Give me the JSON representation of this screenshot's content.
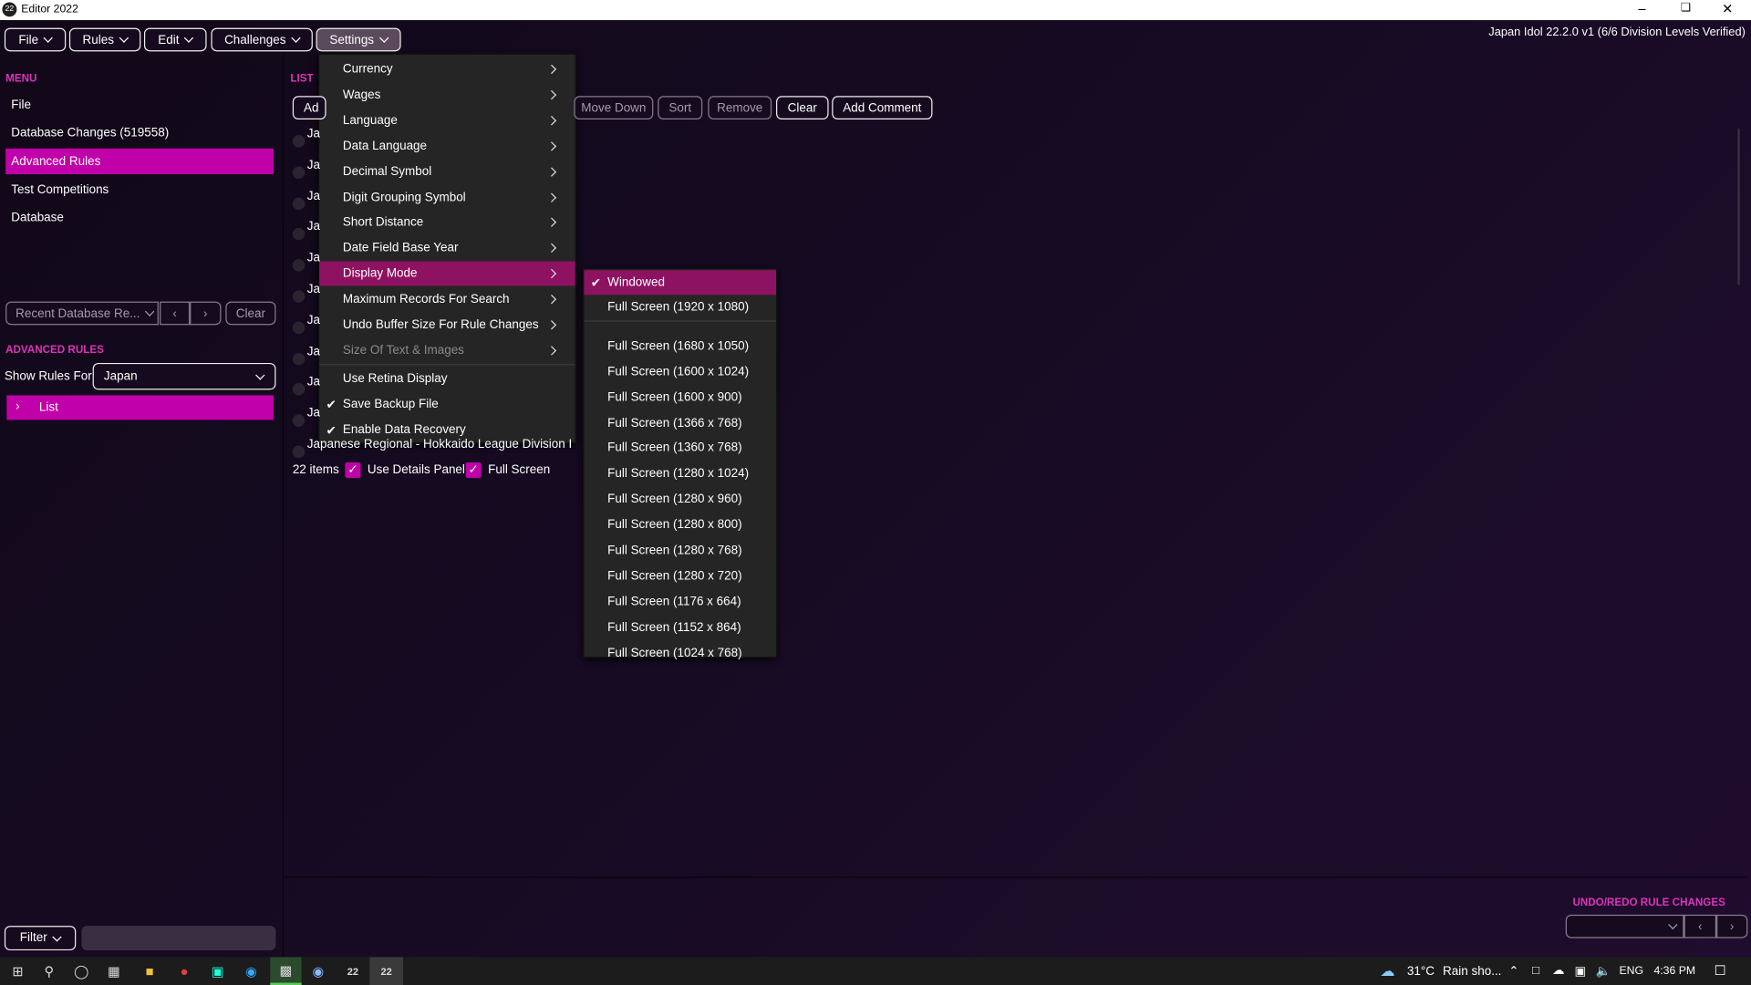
{
  "window": {
    "title": "Editor 2022",
    "version": "Japan Idol 22.2.0 v1 (6/6 Division Levels Verified)"
  },
  "menubar": [
    "File",
    "Rules",
    "Edit",
    "Challenges",
    "Settings"
  ],
  "sidebar": {
    "heading": "MENU",
    "items": [
      "File",
      "Database Changes (519558)",
      "Advanced Rules",
      "Test Competitions",
      "Database"
    ],
    "selected": "Advanced Rules",
    "recent": {
      "label": "Recent Database Re...",
      "clear": "Clear"
    },
    "adv_heading": "ADVANCED RULES",
    "show_rules_label": "Show Rules For",
    "show_rules_value": "Japan",
    "tree_item": "List",
    "filter": {
      "label": "Filter",
      "value": ""
    }
  },
  "list": {
    "heading": "LIST",
    "toolbar": [
      "Ad",
      "Move Down",
      "Sort",
      "Remove",
      "Clear",
      "Add Comment"
    ],
    "rows": [
      "Ja",
      "Ja",
      "Ja",
      "Ja",
      "Ja",
      "Ja",
      "Ja",
      "Ja",
      "Ja",
      "Ja",
      "Japanese Regional - Hokkaido League Division I"
    ],
    "count": "22 items",
    "use_details_panel": {
      "label": "Use Details Panel",
      "checked": true
    },
    "full_screen": {
      "label": "Full Screen",
      "checked": true
    }
  },
  "settings_menu": {
    "items": [
      {
        "label": "Currency",
        "submenu": true
      },
      {
        "label": "Wages",
        "submenu": true
      },
      {
        "label": "Language",
        "submenu": true
      },
      {
        "label": "Data Language",
        "submenu": true
      },
      {
        "label": "Decimal Symbol",
        "submenu": true
      },
      {
        "label": "Digit Grouping Symbol",
        "submenu": true
      },
      {
        "label": "Short Distance",
        "submenu": true
      },
      {
        "label": "Date Field Base Year",
        "submenu": true
      },
      {
        "label": "Display Mode",
        "submenu": true,
        "highlighted": true
      },
      {
        "label": "Maximum Records For Search",
        "submenu": true
      },
      {
        "label": "Undo Buffer Size For Rule Changes",
        "submenu": true
      },
      {
        "label": "Size Of Text & Images",
        "submenu": true,
        "disabled": true
      }
    ],
    "toggles": [
      {
        "label": "Use Retina Display",
        "checked": false
      },
      {
        "label": "Save Backup File",
        "checked": true
      },
      {
        "label": "Enable Data Recovery",
        "checked": true
      }
    ]
  },
  "display_mode_menu": {
    "selected": "Windowed",
    "items": [
      "Windowed",
      "Full Screen (1920 x 1080)",
      "Full Screen (1680 x 1050)",
      "Full Screen (1600 x 1024)",
      "Full Screen (1600 x 900)",
      "Full Screen (1366 x 768)",
      "Full Screen (1360 x 768)",
      "Full Screen (1280 x 1024)",
      "Full Screen (1280 x 960)",
      "Full Screen (1280 x 800)",
      "Full Screen (1280 x 768)",
      "Full Screen (1280 x 720)",
      "Full Screen (1176 x 664)",
      "Full Screen (1152 x 864)",
      "Full Screen (1024 x 768)"
    ]
  },
  "undo": {
    "heading": "UNDO/REDO RULE CHANGES"
  },
  "taskbar": {
    "weather": "31°C",
    "weather_text": "Rain sho...",
    "lang": "ENG",
    "time": "4:36 PM",
    "app_badge": "22"
  },
  "colors": {
    "accent": "#c000a8",
    "menu_highlight": "#8e1262",
    "heading": "#dd33bb",
    "menu_bg": "#252525"
  }
}
